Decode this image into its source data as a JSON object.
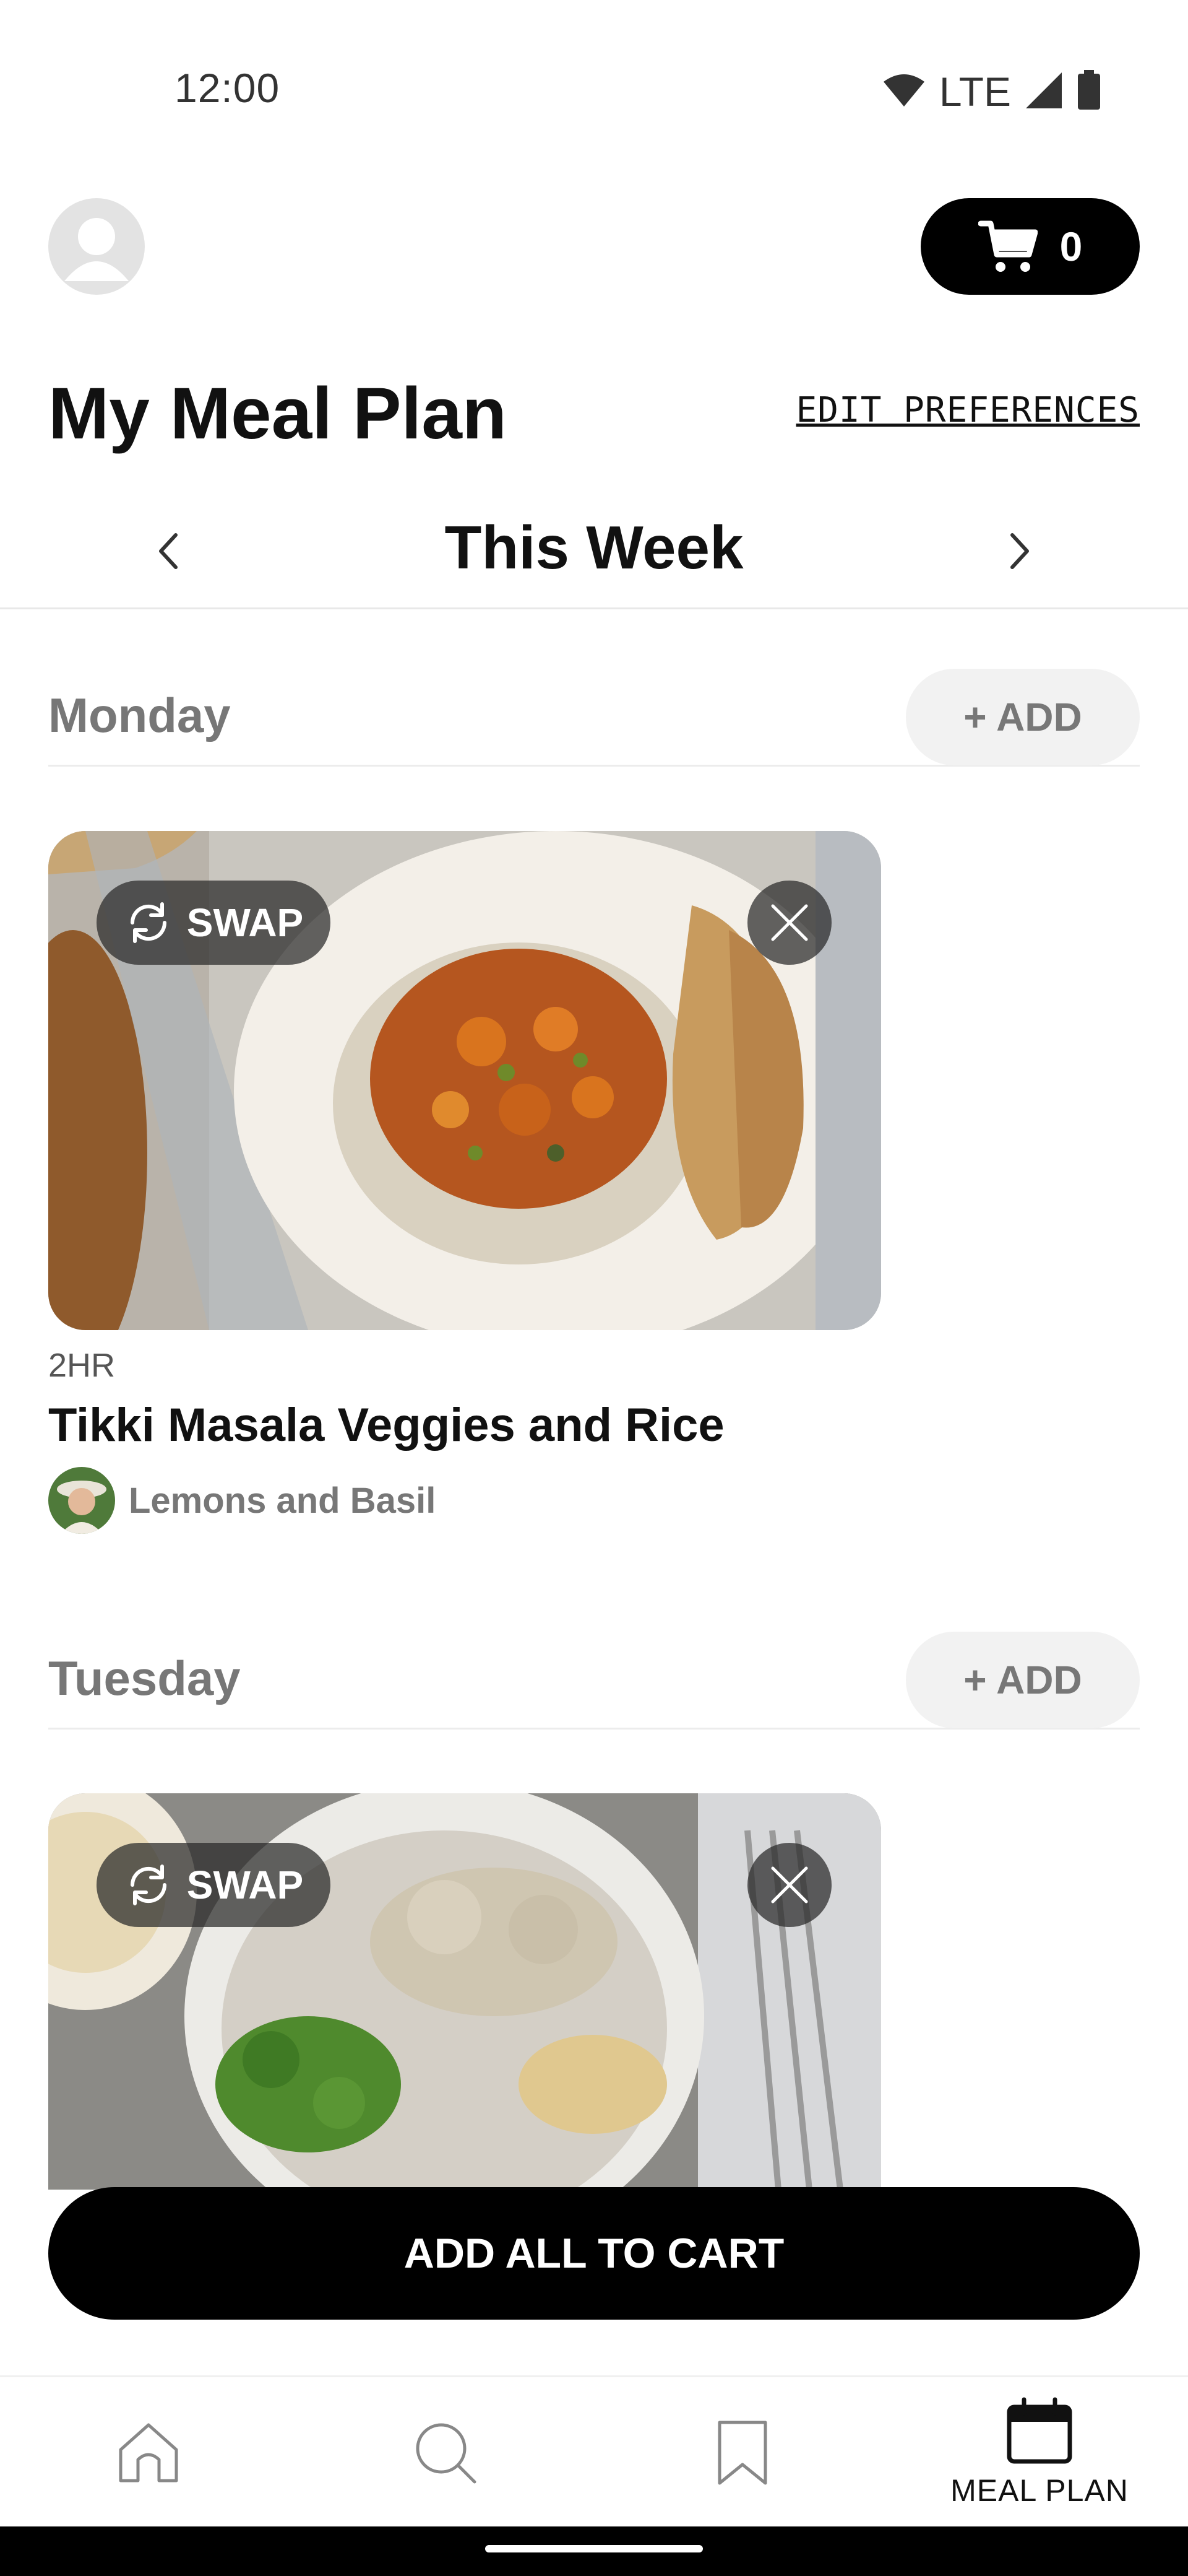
{
  "status_bar": {
    "time": "12:00",
    "network": "LTE",
    "icons": [
      "wifi-icon",
      "signal-icon",
      "battery-icon"
    ]
  },
  "header": {
    "avatar_icon": "profile-icon",
    "cart_icon": "cart-icon",
    "cart_count": "0",
    "title": "My Meal Plan",
    "edit_preferences": "EDIT PREFERENCES"
  },
  "week_nav": {
    "label": "This Week",
    "prev_icon": "chevron-left-icon",
    "next_icon": "chevron-right-icon"
  },
  "days": [
    {
      "name": "Monday",
      "add_label": "+ ADD",
      "meal": {
        "swap_label": "SWAP",
        "time": "2HR",
        "title": "Tikki Masala Veggies and Rice",
        "author": "Lemons and Basil"
      }
    },
    {
      "name": "Tuesday",
      "add_label": "+ ADD",
      "meal": {
        "swap_label": "SWAP"
      }
    }
  ],
  "add_all_label": "ADD ALL TO CART",
  "bottom_nav": {
    "items": [
      {
        "icon": "home-icon",
        "label": ""
      },
      {
        "icon": "search-icon",
        "label": ""
      },
      {
        "icon": "bookmark-icon",
        "label": ""
      },
      {
        "icon": "calendar-icon",
        "label": "MEAL PLAN"
      }
    ]
  },
  "colors": {
    "primary": "#000000",
    "muted_text": "#777777",
    "chip_bg": "#f2f2f2"
  }
}
